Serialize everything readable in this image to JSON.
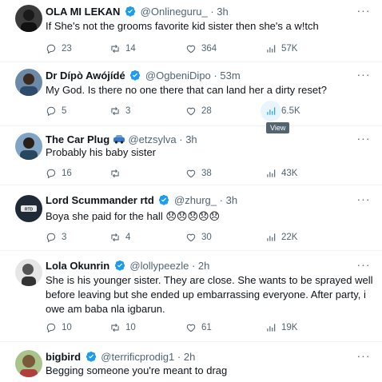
{
  "tweets": [
    {
      "name": "OLA MI LEKAN",
      "handle": "@Onlineguru_",
      "time": "3h",
      "text": "If She's not the grooms favorite kid sister then she's a w!tch",
      "replies": "23",
      "reposts": "14",
      "likes": "364",
      "views": "57K",
      "avatar_color": "#3b3b3b"
    },
    {
      "name": "Dr Dípò Awójídé",
      "handle": "@OgbeniDipo",
      "time": "53m",
      "text": "My God. Is there no one there that can land her a dirty reset?",
      "replies": "5",
      "reposts": "3",
      "likes": "28",
      "views": "6.5K",
      "avatar_color": "#2f4a6b"
    },
    {
      "name": "The Car Plug",
      "name_icon": "car-icon",
      "handle": "@etzsylva",
      "time": "3h",
      "text": "Probably his baby sister",
      "replies": "16",
      "reposts": "",
      "likes": "38",
      "views": "43K",
      "avatar_color": "#27475e"
    },
    {
      "name": "Lord Scummander rtd",
      "handle": "@zhurg_",
      "time": "3h",
      "text": "Boya she paid for the hall",
      "emojis": "😞😞😞😞😞",
      "replies": "3",
      "reposts": "4",
      "likes": "30",
      "views": "22K",
      "avatar_color": "#1f2a36"
    },
    {
      "name": "Lola Okunrin",
      "handle": "@lollypeezle",
      "time": "2h",
      "text": "She is his younger sister. They are close. She wants to be sprayed well before leaving but she ended up embarrassing everyone. After party, i owe am baba nla igbarun.",
      "replies": "10",
      "reposts": "10",
      "likes": "61",
      "views": "19K",
      "avatar_color": "#d8d8d8"
    },
    {
      "name": "bigbird",
      "handle": "@terrificprodig1",
      "time": "2h",
      "text": "Begging someone you're meant to drag",
      "avatar_color": "#7a5a3a"
    }
  ],
  "tooltip": "View",
  "colors": {
    "verified": "#1d9bf0",
    "muted": "#536471",
    "text": "#0f1419",
    "divider": "#eff3f4"
  }
}
